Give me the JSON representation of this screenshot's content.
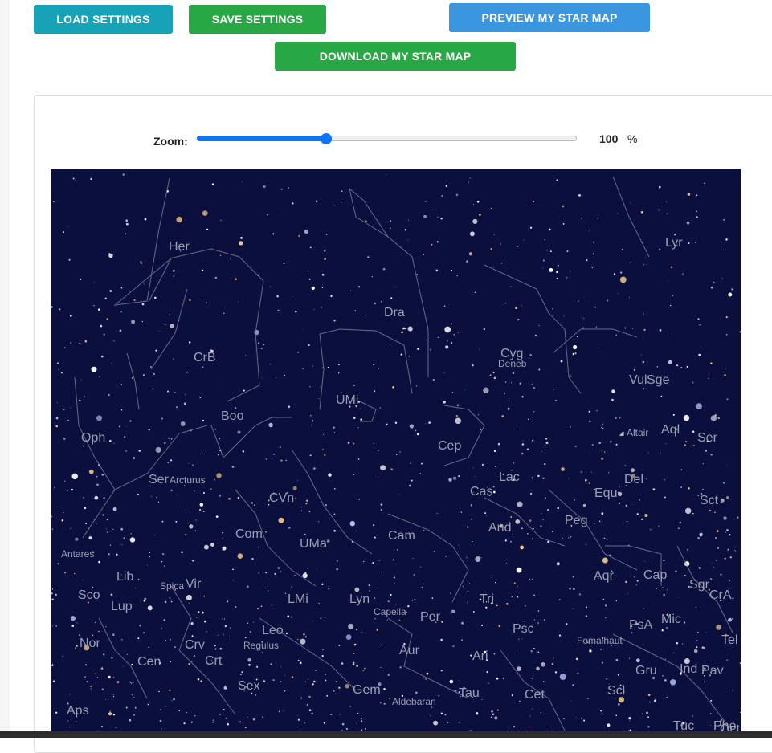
{
  "toolbar": {
    "load_label": "LOAD SETTINGS",
    "save_label": "SAVE SETTINGS",
    "preview_label": "PREVIEW MY STAR MAP",
    "download_label": "DOWNLOAD MY STAR MAP"
  },
  "zoom": {
    "label": "Zoom:",
    "value": "100",
    "unit": "%",
    "slider_fraction": 0.34
  },
  "star_map": {
    "background_color": "#0b0f3d",
    "constellations": [
      "Her",
      "Lyr",
      "Dra",
      "CrB",
      "Cyg",
      "Deneb",
      "Vul",
      "Sge",
      "UMi",
      "Boo",
      "Oph",
      "Altair",
      "Aql",
      "Ser",
      "Cep",
      "Ser",
      "Arcturus",
      "Cas",
      "Lac",
      "Del",
      "CVn",
      "Equ",
      "Sct",
      "And",
      "Peg",
      "Com",
      "UMa",
      "Cam",
      "Antares",
      "Aqr",
      "Cap",
      "Sgr",
      "Lib",
      "Spica",
      "Vir",
      "Sco",
      "Lup",
      "LMi",
      "Lyn",
      "Capella",
      "Per",
      "Tri",
      "Psc",
      "PsA",
      "Mic",
      "CrA",
      "Leo",
      "Regulus",
      "Fomalhaut",
      "Tel",
      "Nor",
      "Crv",
      "Crt",
      "Aur",
      "Ari",
      "Gru",
      "Ind",
      "Pav",
      "Cen",
      "Sex",
      "Gem",
      "Cet",
      "Scl",
      "Tau",
      "Aldebaran",
      "Aps",
      "Phe",
      "Tuc",
      "Oct"
    ]
  },
  "colors": {
    "info": "#17a2b8",
    "success": "#28a745",
    "primary": "#3a97df",
    "slider": "#0a75ff"
  }
}
